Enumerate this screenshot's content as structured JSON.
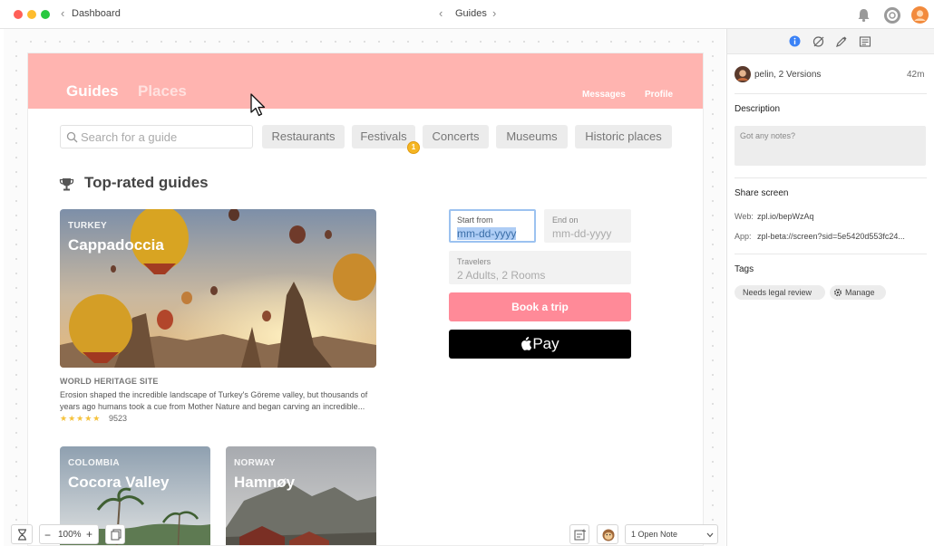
{
  "window": {
    "back_label": "Dashboard",
    "title": "Guides",
    "colors": {
      "close": "#ff5f57",
      "minimize": "#febc2e",
      "maximize": "#28c840"
    }
  },
  "header": {
    "tab_guides": "Guides",
    "tab_places": "Places",
    "link_messages": "Messages",
    "link_profile": "Profile",
    "color": "#ffb4b0"
  },
  "search": {
    "placeholder": "Search for a guide"
  },
  "filters": [
    {
      "label": "Restaurants"
    },
    {
      "label": "Festivals"
    },
    {
      "label": "Concerts"
    },
    {
      "label": "Museums"
    },
    {
      "label": "Historic places"
    }
  ],
  "filter_badge": "1",
  "section": {
    "title": "Top-rated guides",
    "icon": "trophy-icon"
  },
  "featured": {
    "country": "TURKEY",
    "name": "Cappadoccia",
    "site_label": "WORLD HERITAGE SITE",
    "description_line1": "Erosion shaped the incredible landscape of Turkey's Göreme valley, but thousands of",
    "description_line2": "years ago humans took a cue from Mother Nature and began carving an incredible...",
    "stars": "★★★★★",
    "rating_count": "9523"
  },
  "cards": [
    {
      "country": "COLOMBIA",
      "name": "Cocora Valley"
    },
    {
      "country": "NORWAY",
      "name": "Hamnøy"
    }
  ],
  "booking": {
    "start_label": "Start from",
    "start_value": "mm-dd-yyyy",
    "end_label": "End on",
    "end_value": "mm-dd-yyyy",
    "travelers_label": "Travelers",
    "travelers_value": "2 Adults, 2 Rooms",
    "book_button": "Book a trip",
    "apple_pay": "Pay",
    "colors": {
      "book": "#ff8a98",
      "apple": "#000000"
    }
  },
  "toolbar": {
    "zoom": "100%",
    "zoom_out": "−",
    "zoom_in": "+",
    "notes_select": "1 Open Note"
  },
  "panel": {
    "author": "pelin, 2 Versions",
    "time": "42m",
    "description_heading": "Description",
    "notes_placeholder": "Got any notes?",
    "share_heading": "Share screen",
    "web_label": "Web:",
    "web_url": "zpl.io/bepWzAq",
    "app_label": "App:",
    "app_url": "zpl-beta://screen?sid=5e5420d553fc24...",
    "tags_heading": "Tags",
    "tag_1": "Needs legal review",
    "manage_label": "Manage",
    "accent": "#3b82f6"
  }
}
